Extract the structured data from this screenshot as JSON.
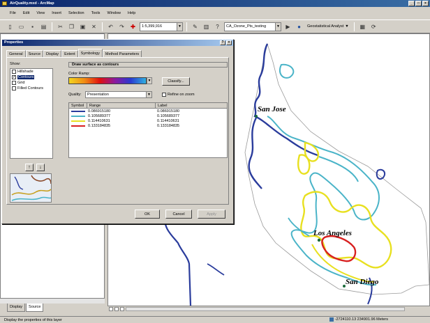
{
  "window": {
    "title": "AirQuality.mxd - ArcMap"
  },
  "menu": [
    "File",
    "Edit",
    "View",
    "Insert",
    "Selection",
    "Tools",
    "Window",
    "Help"
  ],
  "toolbar": {
    "scale": "1:5,399,916",
    "layer": "CA_Ozone_Pts_testing",
    "geostat_label": "Geostatistical Analyst"
  },
  "toc_tabs": [
    "Display",
    "Source"
  ],
  "status": {
    "message": "Display the properties of this layer",
    "coords": "-2724110.13  234901.96 Meters"
  },
  "dialog": {
    "title": "Properties",
    "tabs": [
      "General",
      "Source",
      "Display",
      "Extent",
      "Symbology",
      "Method Parameters"
    ],
    "active_tab": "Symbology",
    "show_label": "Show:",
    "show_items": [
      {
        "label": "Hillshade",
        "checked": false,
        "selected": false
      },
      {
        "label": "Contours",
        "checked": true,
        "selected": true
      },
      {
        "label": "Grid",
        "checked": false,
        "selected": false
      },
      {
        "label": "Filled Contours",
        "checked": false,
        "selected": false
      }
    ],
    "draw_header": "Draw surface as contours",
    "color_ramp_label": "Color Ramp:",
    "classify_label": "Classify...",
    "quality_label": "Quality:",
    "quality_value": "Presentation",
    "refine_label": "Refine on zoom",
    "table_headers": [
      "Symbol",
      "Range",
      "Label"
    ],
    "classes": [
      {
        "color": "#2a3c9c",
        "range": "0.086915180",
        "label": "0.086915180"
      },
      {
        "color": "#4ab4c8",
        "range": "0.105689377",
        "label": "0.105689377"
      },
      {
        "color": "#e8e020",
        "range": "0.114410631",
        "label": "0.114410631"
      },
      {
        "color": "#d82020",
        "range": "0.133184835",
        "label": "0.133184835"
      }
    ],
    "ok_label": "OK",
    "cancel_label": "Cancel",
    "apply_label": "Apply"
  },
  "map": {
    "cities": [
      "San Jose",
      "Los Angeles",
      "San Diego"
    ]
  }
}
